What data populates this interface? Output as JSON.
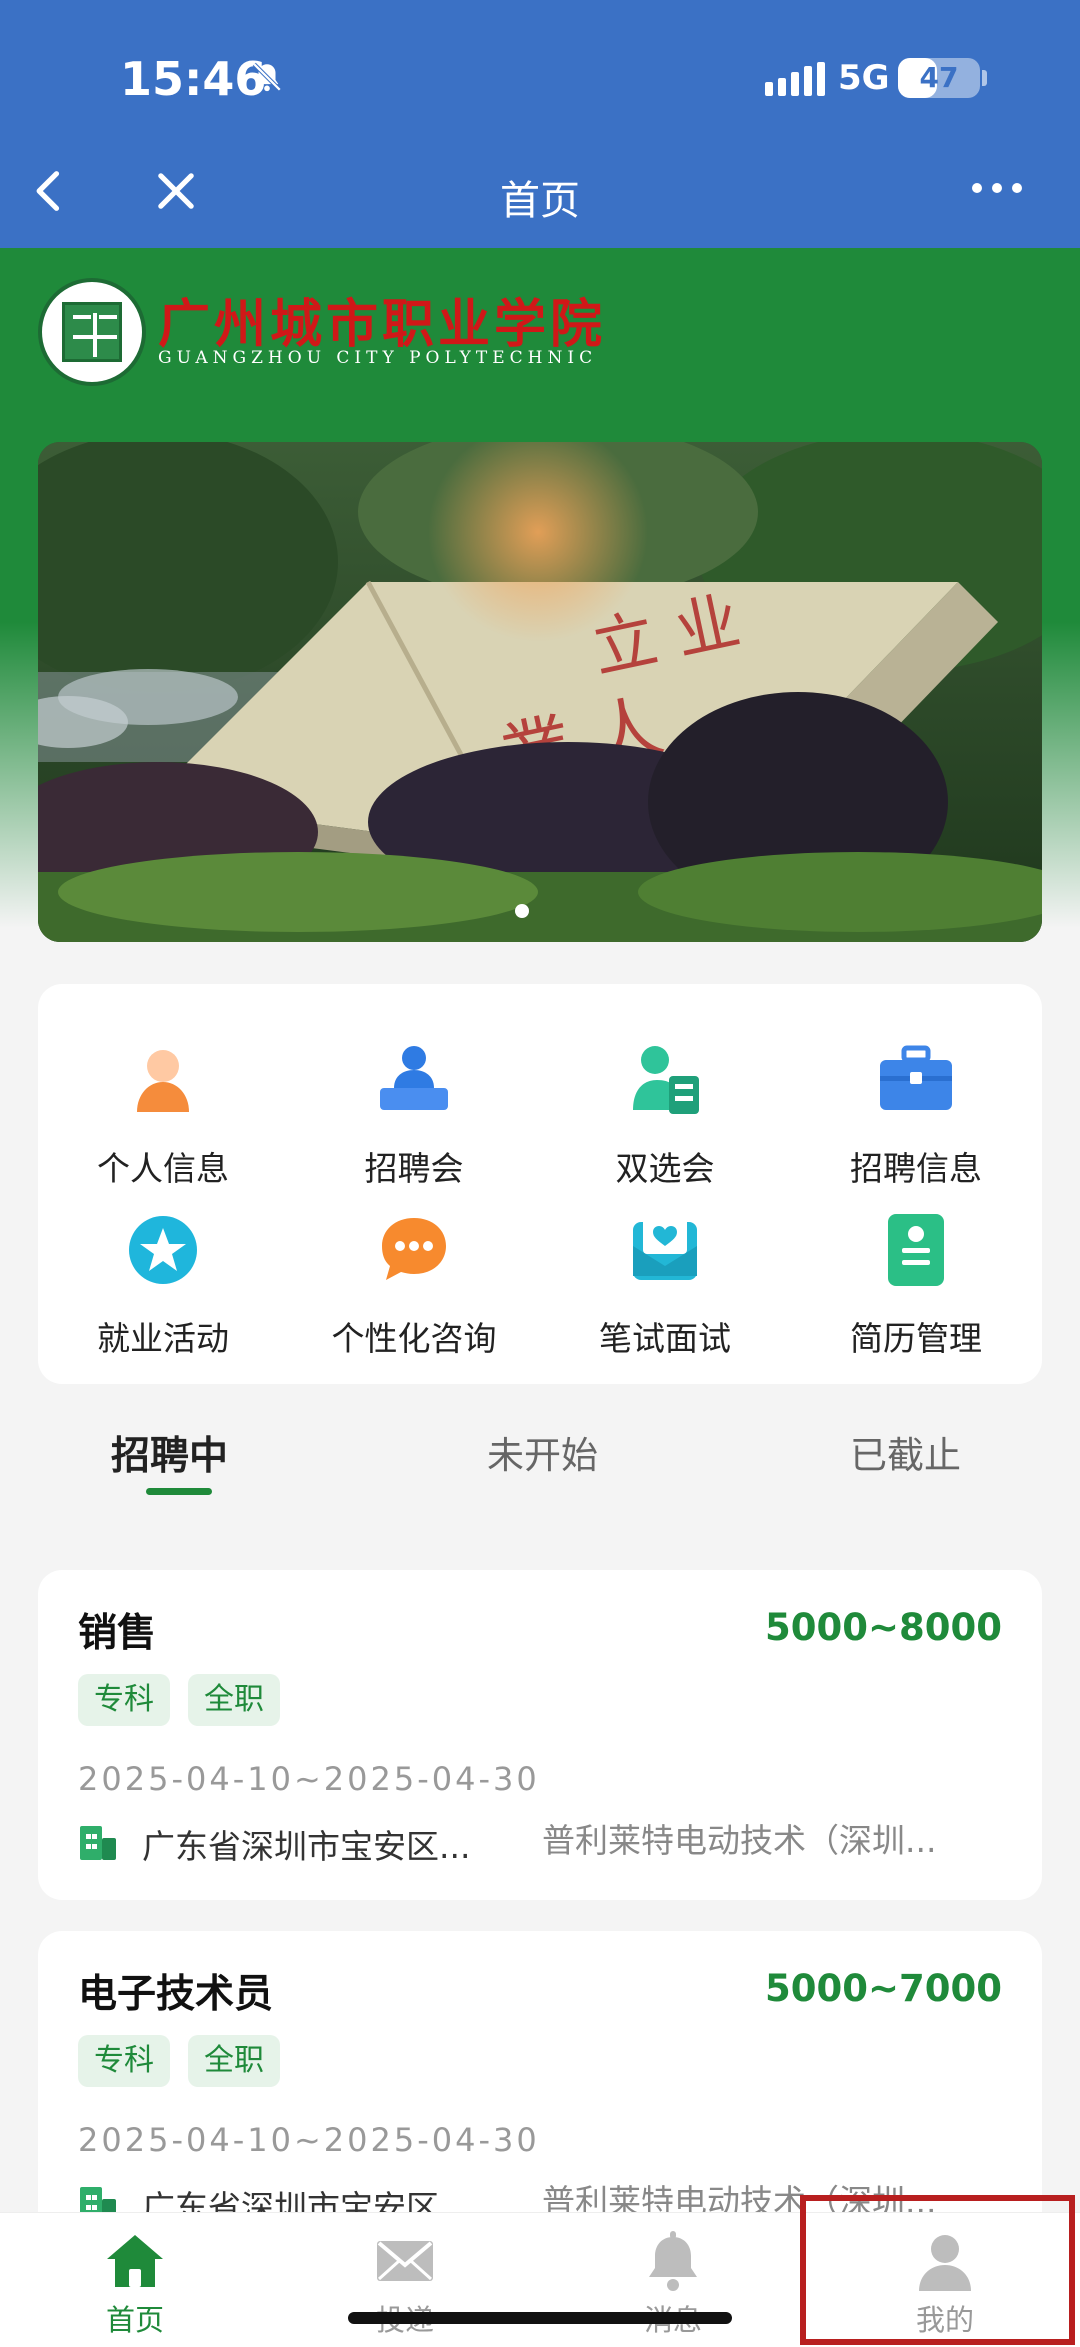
{
  "status_bar": {
    "time": "15:46",
    "network": "5G",
    "battery": "47",
    "battery_level": 0.47
  },
  "nav": {
    "title": "首页"
  },
  "brand": {
    "name_cn": "广州城市职业学院",
    "name_en": "GUANGZHOU CITY POLYTECHNIC"
  },
  "features": [
    {
      "label": "个人信息",
      "icon": "person-icon"
    },
    {
      "label": "招聘会",
      "icon": "presenter-icon"
    },
    {
      "label": "双选会",
      "icon": "user-card-icon"
    },
    {
      "label": "招聘信息",
      "icon": "briefcase-icon"
    },
    {
      "label": "就业活动",
      "icon": "star-icon"
    },
    {
      "label": "个性化咨询",
      "icon": "chat-bubble-icon"
    },
    {
      "label": "笔试面试",
      "icon": "envelope-heart-icon"
    },
    {
      "label": "简历管理",
      "icon": "resume-icon"
    }
  ],
  "tabs": [
    {
      "label": "招聘中",
      "active": true
    },
    {
      "label": "未开始",
      "active": false
    },
    {
      "label": "已截止",
      "active": false
    }
  ],
  "jobs": [
    {
      "title": "销售",
      "salary": "5000~8000",
      "tags": [
        "专科",
        "全职"
      ],
      "date": "2025-04-10~2025-04-30",
      "address": "广东省深圳市宝安区...",
      "company": "普利莱特电动技术（深圳..."
    },
    {
      "title": "电子技术员",
      "salary": "5000~7000",
      "tags": [
        "专科",
        "全职"
      ],
      "date": "2025-04-10~2025-04-30",
      "address": "广东省深圳市宝安区...",
      "company": "普利莱特电动技术（深圳..."
    }
  ],
  "bottom_nav": [
    {
      "label": "首页",
      "icon": "home-icon",
      "active": true
    },
    {
      "label": "投递",
      "icon": "mail-icon",
      "active": false
    },
    {
      "label": "消息",
      "icon": "bell-icon",
      "active": false
    },
    {
      "label": "我的",
      "icon": "profile-icon",
      "active": false
    }
  ],
  "colors": {
    "brand_green": "#1f8a3a",
    "nav_blue": "#3b71c5",
    "highlight_red": "#b81f1f"
  }
}
